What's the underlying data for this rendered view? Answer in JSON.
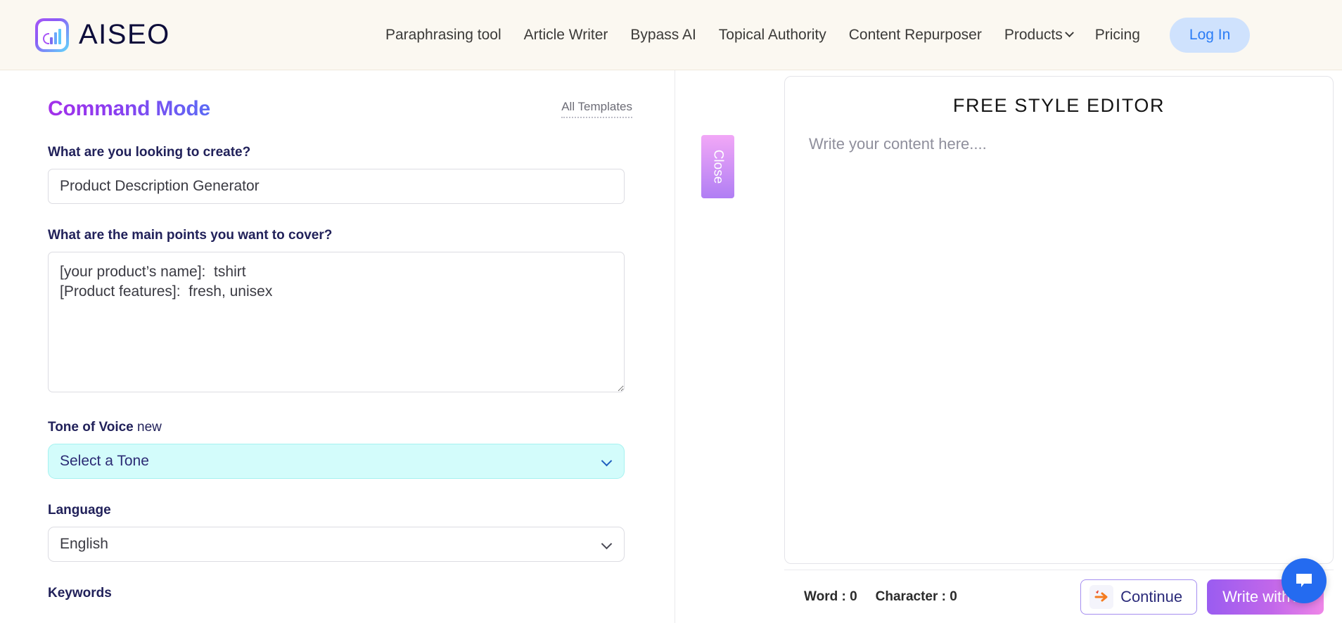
{
  "nav": {
    "brand": "AISEO",
    "links": [
      {
        "label": "Paraphrasing tool",
        "has_caret": false
      },
      {
        "label": "Article Writer",
        "has_caret": false
      },
      {
        "label": "Bypass AI",
        "has_caret": false
      },
      {
        "label": "Topical Authority",
        "has_caret": false
      },
      {
        "label": "Content Repurposer",
        "has_caret": false
      },
      {
        "label": "Products",
        "has_caret": true
      },
      {
        "label": "Pricing",
        "has_caret": false
      }
    ],
    "login_label": "Log In",
    "login_bg": "#cfe2fd",
    "login_color": "#2a7cf6",
    "bar_bg": "#fbf8f1"
  },
  "left": {
    "title": "Command Mode",
    "title_gradient_from": "#a32fea",
    "title_gradient_to": "#5b6bf5",
    "all_templates": "All Templates",
    "create_label": "What are you looking to create?",
    "create_value": "Product Description Generator",
    "main_points_label": "What are the main points you want to cover?",
    "main_points_value": "[your product’s name]:  tshirt\n[Product features]:  fresh, unisex",
    "tone_label": "Tone of Voice",
    "tone_badge": "new",
    "tone_value": "Select a Tone",
    "tone_bg": "#d3fcfb",
    "language_label": "Language",
    "language_value": "English",
    "keywords_label": "Keywords"
  },
  "close_tab": {
    "label": "Close",
    "gradient_from": "#f2a8f7",
    "gradient_to": "#b07ef4"
  },
  "editor": {
    "title": "FREE STYLE EDITOR",
    "placeholder": "Write your content here....",
    "word_count": "Word : 0",
    "character_count": "Character : 0",
    "continue_label": "Continue",
    "write_ai_label": "Write with AI",
    "write_ai_gradient_from": "#9a5cf0",
    "write_ai_gradient_to": "#ef86e8"
  },
  "chat": {
    "accent": "#246bf0"
  }
}
